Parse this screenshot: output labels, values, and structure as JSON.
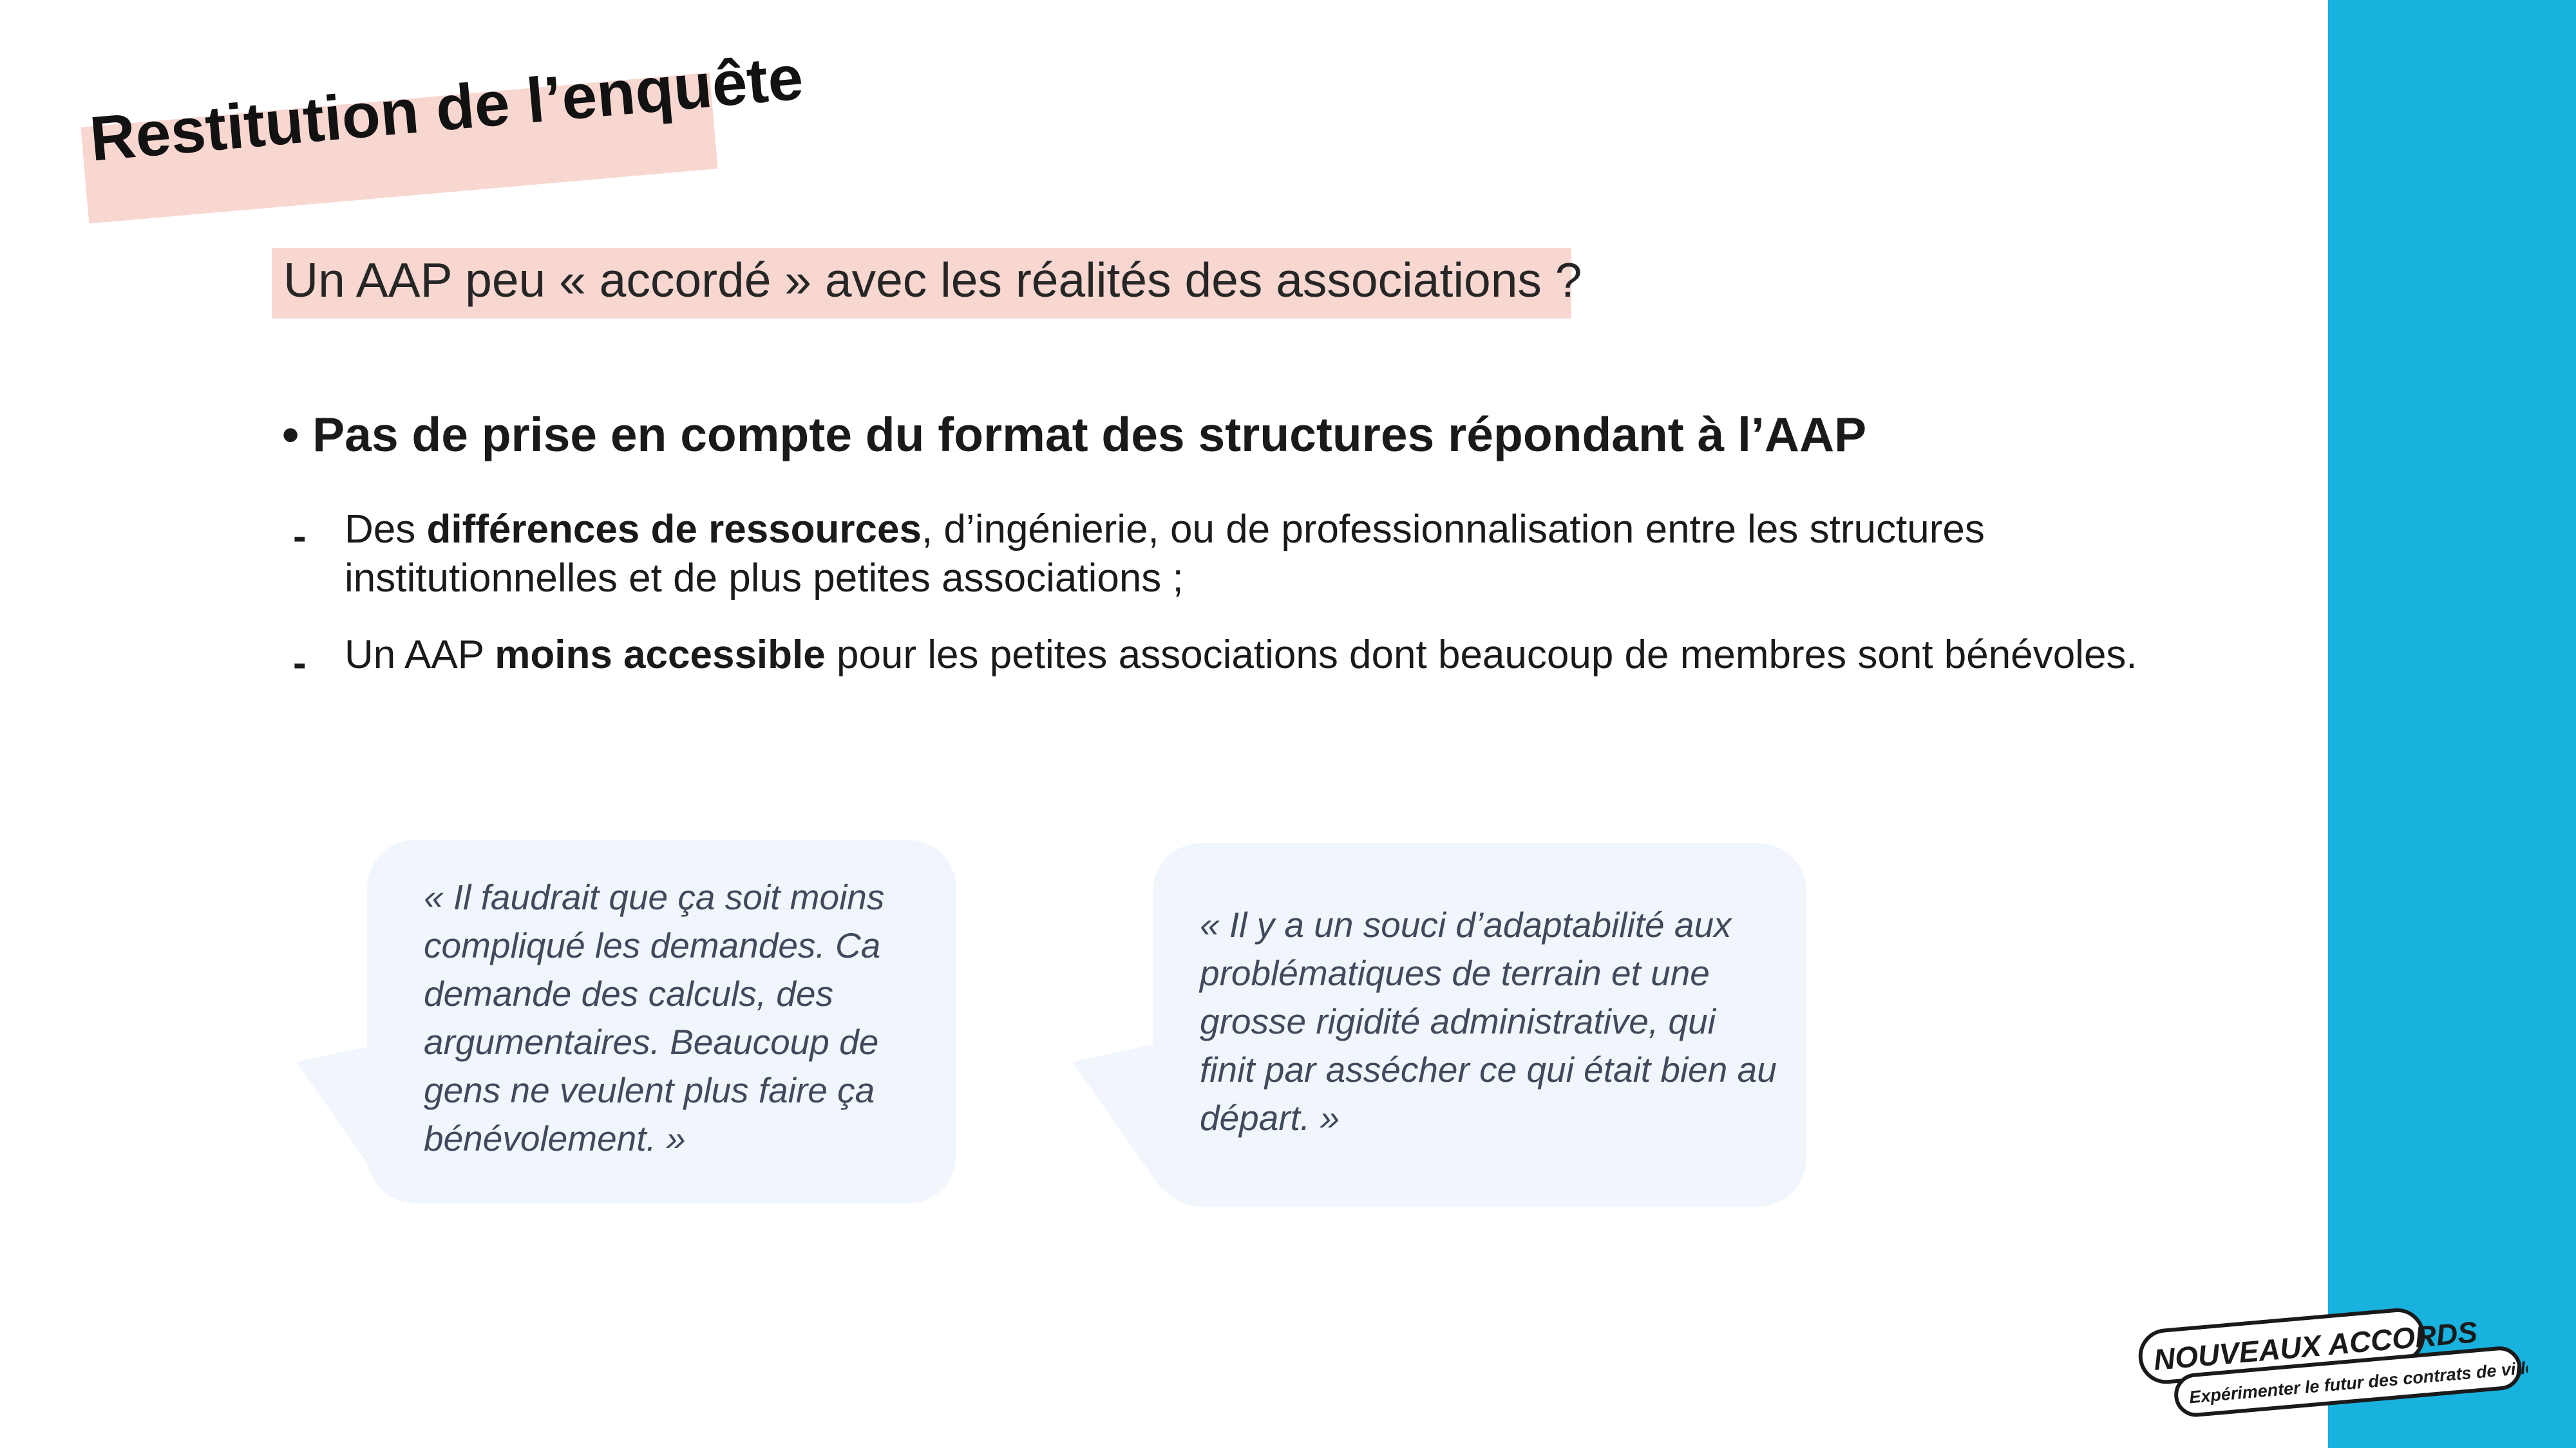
{
  "section_title": "Restitution de l’enquête",
  "subtitle": "Un AAP peu « accordé » avec les réalités des associations ?",
  "heading": "• Pas de prise en compte du format des structures répondant à l’AAP",
  "bullet_marker": "-",
  "items": [
    {
      "line1_pre": "Des ",
      "line1_bold": "différences de ressources",
      "line1_post": ", d’ingénierie, ou de professionnalisation entre les structures",
      "line2": "institutionnelles et de plus petites associations ;"
    },
    {
      "pre": "Un AAP ",
      "bold": "moins accessible",
      "post": " pour les petites associations dont beaucoup de membres sont bénévoles."
    }
  ],
  "quotes": [
    {
      "lines": [
        "« Il faudrait que ça soit moins",
        "compliqué les demandes. Ca",
        "demande des calculs, des",
        "argumentaires. Beaucoup de",
        "gens ne veulent plus faire ça",
        "bénévolement. »"
      ]
    },
    {
      "lines": [
        "« Il y a un souci d’adaptabilité aux",
        "problématiques de terrain et une",
        "grosse rigidité administrative, qui",
        "finit par assécher ce qui était bien au",
        "départ. »"
      ]
    }
  ],
  "logo": {
    "name": "NOUVEAUX ACCORDS",
    "tagline": "Expérimenter le futur des contrats de ville"
  },
  "colors": {
    "accent_band": "#19b1de",
    "highlight": "#f8d7d1",
    "bubble": "#f0f6fb",
    "quote_text": "#404a5c"
  }
}
